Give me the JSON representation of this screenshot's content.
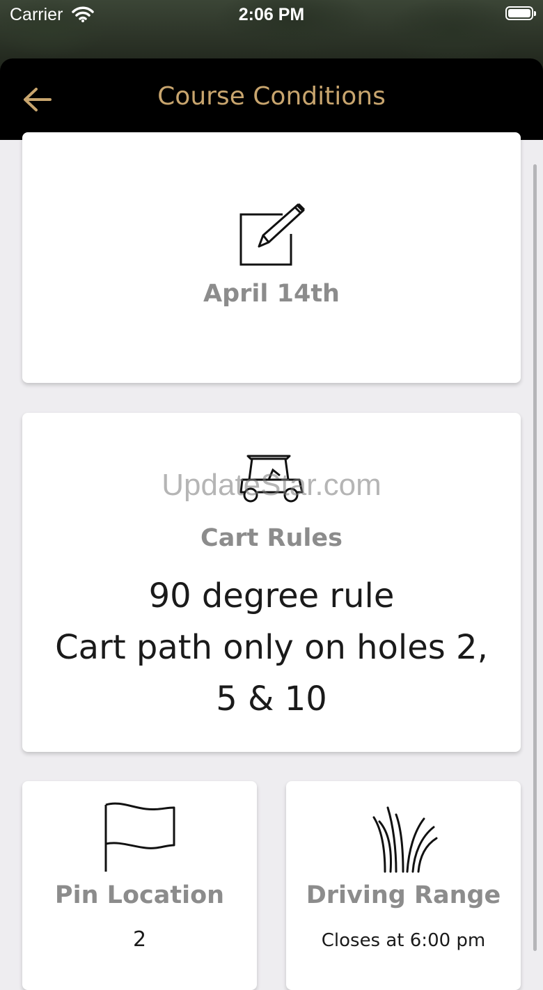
{
  "status_bar": {
    "carrier": "Carrier",
    "time": "2:06 PM"
  },
  "nav": {
    "title": "Course Conditions",
    "back_icon": "arrow-left-icon",
    "title_color": "#c8a56e"
  },
  "cards": {
    "date": {
      "icon": "edit-note-icon",
      "label": "April 14th"
    },
    "cart_rules": {
      "icon": "golf-cart-icon",
      "label": "Cart Rules",
      "lines": [
        "90 degree rule",
        "Cart path only on holes 2,",
        "5 & 10"
      ]
    },
    "pin_location": {
      "icon": "flag-icon",
      "label": "Pin Location",
      "value": "2"
    },
    "driving_range": {
      "icon": "grass-icon",
      "label": "Driving Range",
      "value": "Closes at 6:00 pm"
    }
  },
  "watermark": "UpdateStar.com"
}
